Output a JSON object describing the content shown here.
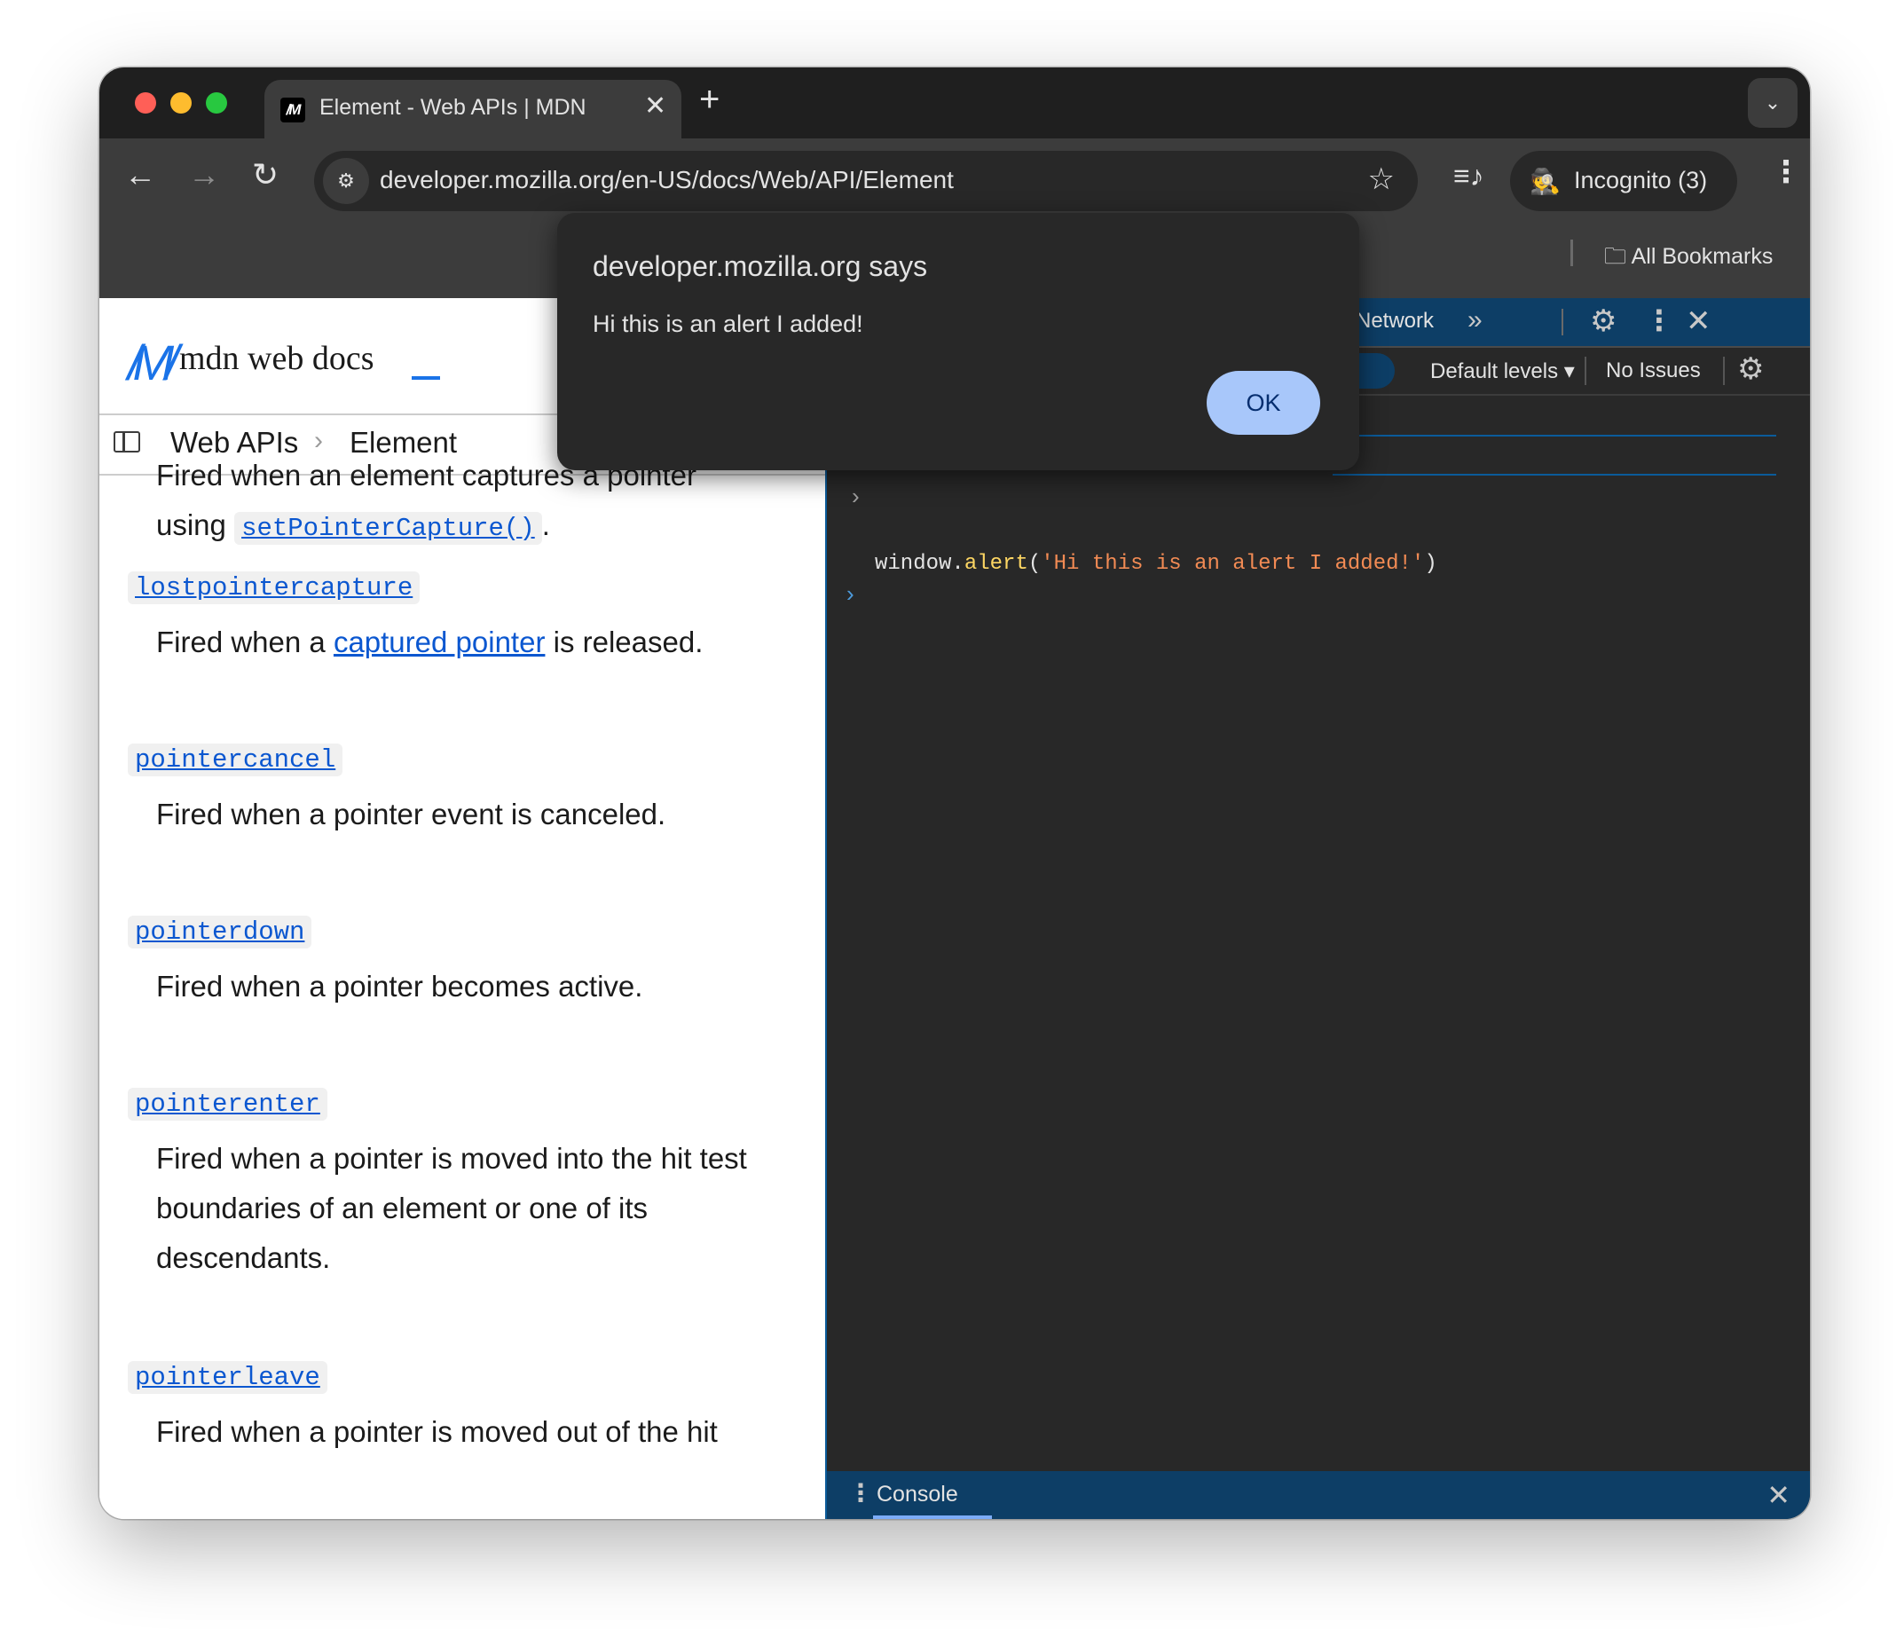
{
  "browser": {
    "tab_title": "Element - Web APIs | MDN",
    "favicon": "MDN logo",
    "url": "developer.mozilla.org/en-US/docs/Web/API/Element",
    "incognito_label": "Incognito (3)",
    "bookmarks_label": "All Bookmarks",
    "traffic_lights": [
      "#ff5f57",
      "#febc2e",
      "#28c840"
    ]
  },
  "page": {
    "logo_text": "mdn web docs",
    "breadcrumb": [
      "Web APIs",
      "Element"
    ],
    "top_desc_line1": "Fired when an element captures a pointer",
    "top_desc_prefix": "using",
    "top_desc_code": "setPointerCapture()",
    "top_desc_suffix": ".",
    "events": [
      {
        "name": "lostpointercapture",
        "desc_prefix": "Fired when a ",
        "desc_link": "captured pointer",
        "desc_suffix": " is released."
      },
      {
        "name": "pointercancel",
        "desc": "Fired when a pointer event is canceled."
      },
      {
        "name": "pointerdown",
        "desc": "Fired when a pointer becomes active."
      },
      {
        "name": "pointerenter",
        "desc": "Fired when a pointer is moved into the hit test boundaries of an element or one of its descendants."
      },
      {
        "name": "pointerleave",
        "desc": "Fired when a pointer is moved out of the hit"
      }
    ]
  },
  "devtools": {
    "tab_network": "Network",
    "levels_label": "Default levels",
    "issues_label": "No Issues",
    "command_obj": "window.",
    "command_fn": "alert",
    "command_open": "(",
    "command_str": "'Hi this is an alert I added!'",
    "command_close": ")",
    "drawer_tab": "Console"
  },
  "alert": {
    "title": "developer.mozilla.org says",
    "message": "Hi this is an alert I added!",
    "ok_label": "OK"
  }
}
